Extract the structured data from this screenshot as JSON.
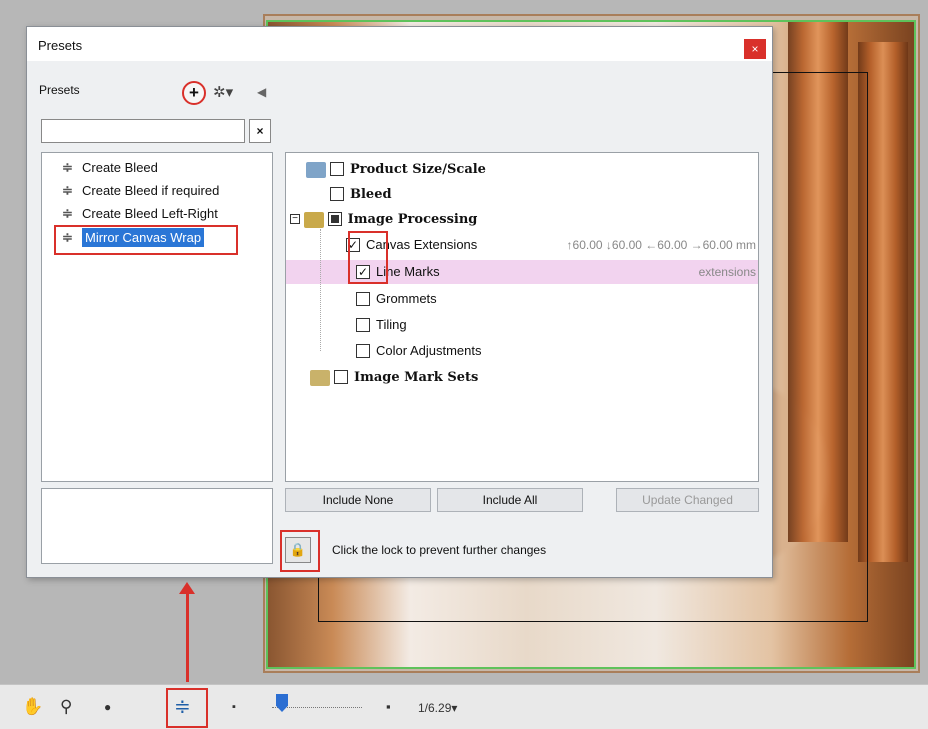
{
  "dialog": {
    "title": "Presets",
    "close_label": "×",
    "presets_label": "Presets",
    "add_label": "+",
    "gear_label": "✲▾",
    "collapse_label": "◀",
    "search_value": "",
    "clear_label": "×"
  },
  "presets": [
    {
      "label": "Create Bleed"
    },
    {
      "label": "Create Bleed if required"
    },
    {
      "label": "Create Bleed Left-Right"
    },
    {
      "label": "Mirror Canvas Wrap"
    }
  ],
  "settings": {
    "product_size": "Product Size/Scale",
    "bleed": "Bleed",
    "image_processing": "Image Processing",
    "canvas_extensions": "Canvas Extensions",
    "canvas_extensions_values": "↑60.00  ↓60.00  ←60.00  →60.00 mm",
    "line_marks": "Line Marks",
    "line_marks_note": "extensions",
    "grommets": "Grommets",
    "tiling": "Tiling",
    "color_adjustments": "Color Adjustments",
    "image_mark_sets": "Image Mark Sets",
    "expander": "−"
  },
  "buttons": {
    "include_none": "Include None",
    "include_all": "Include All",
    "update_changed": "Update Changed"
  },
  "lock_text": "Click the lock to prevent further changes",
  "toolbar": {
    "zoom_value": "1/6.29▾"
  },
  "colors": {
    "highlight": "#d9302a",
    "selection": "#2a76d6",
    "row_highlight": "#f2d3ef"
  }
}
